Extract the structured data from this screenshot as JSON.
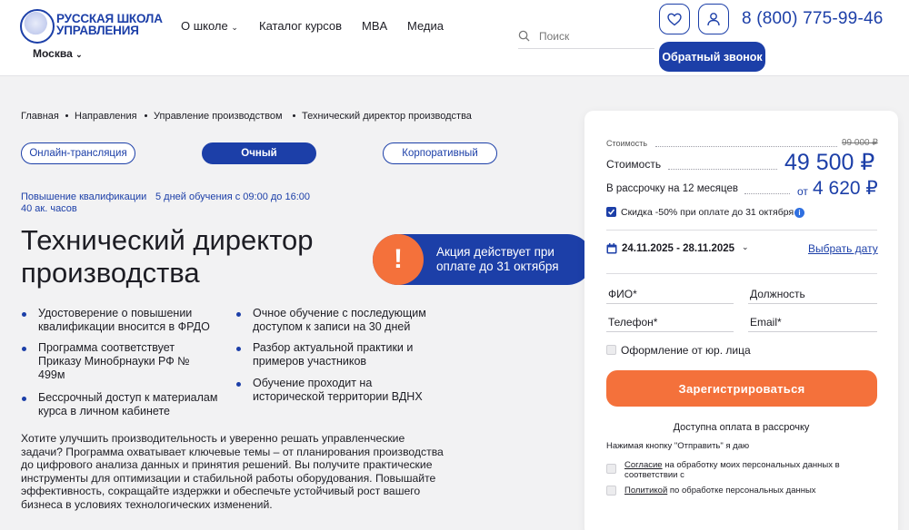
{
  "header": {
    "logo_text": "РУССКАЯ ШКОЛА УПРАВЛЕНИЯ",
    "city": "Москва",
    "nav": [
      "О школе",
      "Каталог курсов",
      "MBA",
      "Медиа"
    ],
    "search_placeholder": "Поиск",
    "phone": "8 (800) 775-99-46",
    "callback_label": "Обратный звонок",
    "icons": [
      "heart-icon",
      "user-icon",
      "search-icon"
    ]
  },
  "breadcrumbs": [
    "Главная",
    "Направления",
    "Управление производством",
    "Технический директор производства"
  ],
  "formats": [
    "Онлайн-трансляция",
    "Очный",
    "Корпоративный"
  ],
  "active_format": "Очный",
  "meta": {
    "type": "Повышение квалификации",
    "schedule": "5 дней обучения с 09:00 до 16:00",
    "hours": "40 ак. часов"
  },
  "title": "Технический директор производства",
  "promo": "Акция действует при оплате до 31 октября",
  "bullets_left": [
    "Удостоверение о повышении квалификации вносится в ФРДО",
    "Программа соответствует Приказу Минобрнауки РФ № 499м",
    "Бессрочный доступ к материалам курса в личном кабинете"
  ],
  "bullets_right": [
    "Очное обучение с последующим доступом к записи на 30 дней",
    "Разбор актуальной практики и примеров участников",
    "Обучение проходит на исторической территории ВДНХ"
  ],
  "description": "Хотите улучшить производительность и уверенно решать управленческие задачи? Программа охватывает ключевые темы – от планирования производства до цифрового анализа данных и принятия решений. Вы получите практические инструменты для оптимизации и стабильной работы оборудования. Повышайте эффективность, сокращайте издержки и обеспечьте устойчивый рост вашего бизнеса в условиях технологических изменений.",
  "card": {
    "old_price_label": "Стоимость",
    "old_price": "99 000 ₽",
    "price_label": "Стоимость",
    "price": "49 500 ₽",
    "installment_label": "В рассрочку на 12 месяцев",
    "installment_prefix": "от",
    "installment_price": "4 620 ₽",
    "discount_label": "Скидка -50% при оплате до 31 октября",
    "discount_checked": true,
    "dates": "24.11.2025 - 28.11.2025",
    "choose_date": "Выбрать дату",
    "fields": {
      "fio": "ФИО*",
      "position": "Должность",
      "phone": "Телефон*",
      "email": "Email*"
    },
    "legal_entity": "Оформление от юр. лица",
    "register_label": "Зарегистрироваться",
    "installment_note": "Доступна оплата в рассрочку",
    "consent_note": "Нажимая кнопку \"Отправить\" я даю",
    "consent1_link": "Согласие",
    "consent1_text": "на обработку моих персональных данных в соответствии с",
    "consent2_link": "Политикой",
    "consent2_text": "по обработке персональных данных"
  },
  "colors": {
    "accent": "#1c3fa8",
    "orange": "#f4713b",
    "background": "#f2f2f3"
  }
}
